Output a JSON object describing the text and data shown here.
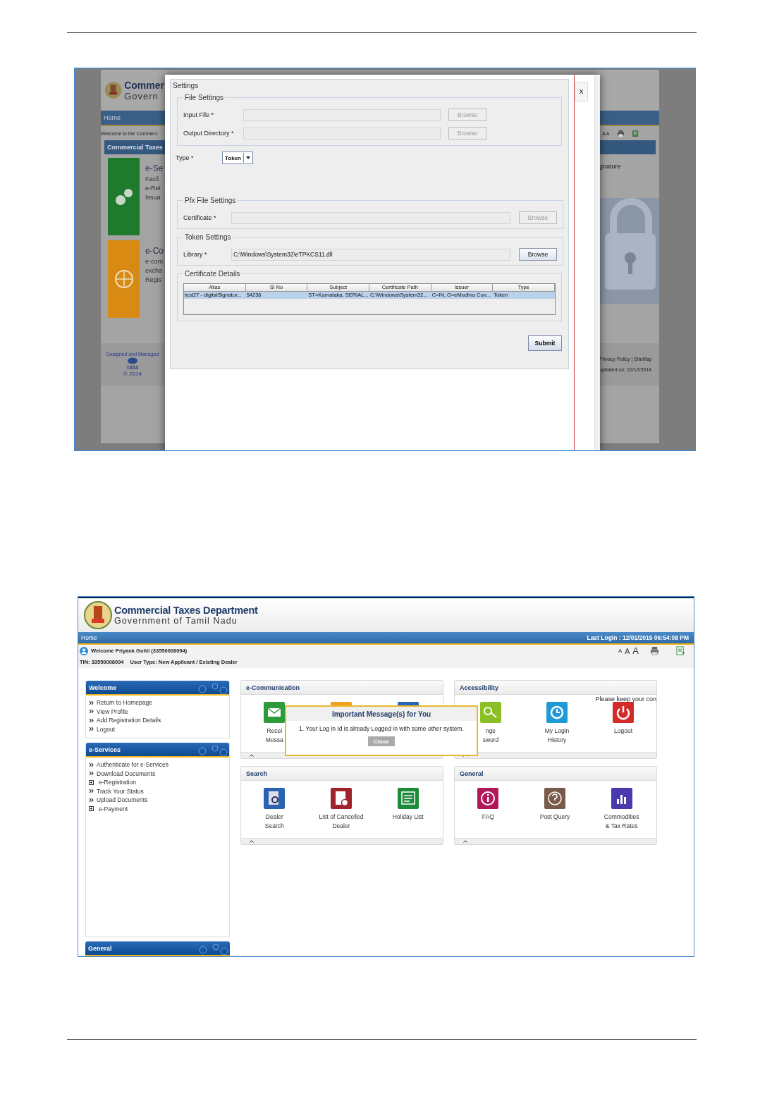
{
  "screenshot_1": {
    "background_page": {
      "logo_title": "Commer",
      "logo_subtitle": "Govern",
      "nav": "Home",
      "welcome": "Welcome to the Commerc",
      "font_sizes": "A A",
      "panel_title": "Commercial Taxes",
      "cards": [
        {
          "title": "e-Se",
          "lines": [
            "Facil",
            "e-Ret",
            "Issua"
          ],
          "color": "#1f7a2e"
        },
        {
          "title": "e-Co",
          "lines": [
            "e-com",
            "excha",
            "Regis"
          ],
          "color": "#d98a12"
        }
      ],
      "right_text": "gnature",
      "footer_credit": "Designed and Managed",
      "footer_logo": "TATA",
      "copyright": "© 2014",
      "footer_links": "Privacy Policy  |  SiteMap",
      "updated": "updated on: 10/12/2014"
    },
    "dialog": {
      "close": "X",
      "title": "Settings",
      "file_settings": {
        "legend": "File Settings",
        "fields": [
          {
            "label": "Input File *",
            "button": "Browse",
            "disabled": true
          },
          {
            "label": "Output Directory *",
            "button": "Browse",
            "disabled": true
          }
        ]
      },
      "type": {
        "label": "Type *",
        "value": "Token"
      },
      "pfx_settings": {
        "legend": "Pfx File Settings",
        "fields": [
          {
            "label": "Certificate *",
            "button": "Browse",
            "disabled": true
          }
        ]
      },
      "token_settings": {
        "legend": "Token Settings",
        "fields": [
          {
            "label": "Library *",
            "value": "C:\\Windows\\System32\\eTPKCS11.dll",
            "button": "Browse",
            "disabled": false
          }
        ]
      },
      "certificate_details": {
        "legend": "Certificate Details",
        "columns": [
          "Alias",
          "Sl No",
          "Subject",
          "Certificate Path",
          "Issuer",
          "Type"
        ],
        "rows": [
          {
            "cells": [
              "test27 - digitalSignatur...",
              "54236",
              "ST=Karnataka, SERIAL...",
              "C:\\Windows\\System32...",
              "C=IN, O=eMudhra Con...",
              "Token"
            ],
            "selected": true
          }
        ]
      },
      "submit": "Submit"
    }
  },
  "screenshot_2": {
    "header": {
      "title": "Commercial Taxes Department",
      "subtitle": "Government of Tamil Nadu"
    },
    "nav": {
      "home": "Home",
      "last_login": "Last Login : 12/01/2015 06:54:08 PM"
    },
    "user_bar": {
      "welcome": "Welcome Priyank Gohil (33550008094)",
      "tin": "TIN: 33550008094",
      "user_type": "User Type: New Applicant / Existing Dealer",
      "font_sizes": [
        "A",
        "A",
        "A"
      ]
    },
    "sidebar": [
      {
        "title": "Welcome",
        "items": [
          {
            "kind": "link",
            "label": "Return to Homepage"
          },
          {
            "kind": "link",
            "label": "View Profile"
          },
          {
            "kind": "link",
            "label": "Add Registration Details"
          },
          {
            "kind": "link",
            "label": "Logout"
          }
        ]
      },
      {
        "title": "e-Services",
        "items": [
          {
            "kind": "link",
            "label": "Authenticate for e-Services"
          },
          {
            "kind": "link",
            "label": "Download Documents"
          },
          {
            "kind": "expandable",
            "label": "e-Registration"
          },
          {
            "kind": "link",
            "label": "Track Your Status"
          },
          {
            "kind": "link",
            "label": "Upload Documents"
          },
          {
            "kind": "expandable",
            "label": "e-Payment"
          }
        ]
      },
      {
        "title": "General"
      }
    ],
    "panels": [
      {
        "title": "e-Communication",
        "items": [
          {
            "lines": [
              "Recei",
              "Messa"
            ],
            "color": "#2e9a3a"
          },
          {
            "color": "#f0a020"
          },
          {
            "color": "#2a66b8"
          }
        ]
      },
      {
        "title": "Accessibility",
        "note": "Please keep your con",
        "items": [
          {
            "lines": [
              "nge",
              "sword"
            ],
            "color": "#8cbf26"
          },
          {
            "lines": [
              "My Login",
              "History"
            ],
            "color": "#1e9ad6"
          },
          {
            "lines": [
              "Logout"
            ],
            "color": "#d42a2a"
          }
        ]
      },
      {
        "title": "Search",
        "items": [
          {
            "lines": [
              "Dealer",
              "Search"
            ],
            "color": "#2a63b0"
          },
          {
            "lines": [
              "List of Cancelled",
              "Dealer"
            ],
            "color": "#a0222a"
          },
          {
            "lines": [
              "Holiday List"
            ],
            "color": "#1f8a3a"
          }
        ]
      },
      {
        "title": "General",
        "items": [
          {
            "lines": [
              "FAQ"
            ],
            "color": "#b0185a"
          },
          {
            "lines": [
              "Post Query"
            ],
            "color": "#7a5a48"
          },
          {
            "lines": [
              "Commodities",
              "& Tax Rates"
            ],
            "color": "#4a3ab0"
          }
        ]
      }
    ],
    "message_box": {
      "title": "Important Message(s) for You",
      "message": "1. Your Log in Id is already Logged in with some other system.",
      "button": "Close"
    }
  }
}
